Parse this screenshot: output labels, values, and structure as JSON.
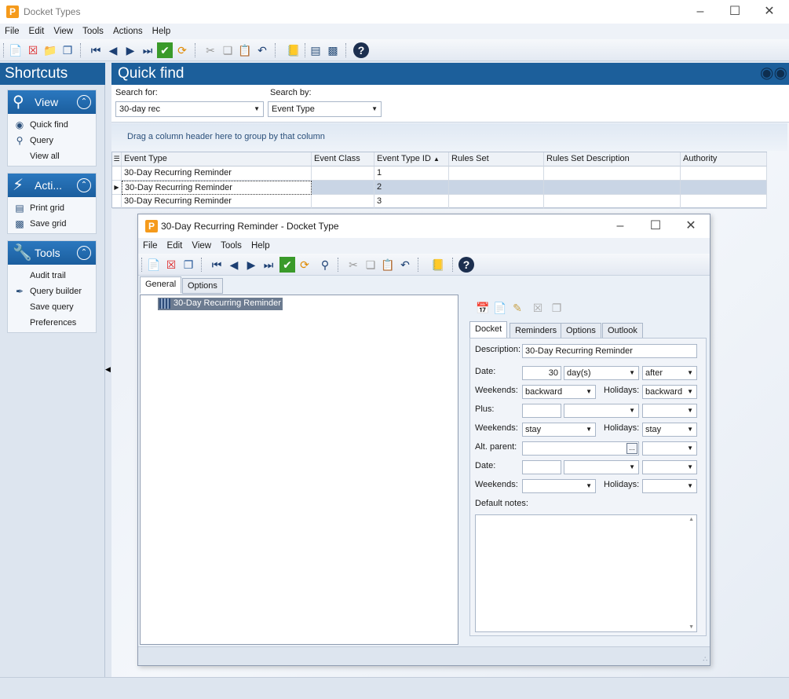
{
  "window": {
    "title": "Docket Types"
  },
  "menu": [
    "File",
    "Edit",
    "View",
    "Tools",
    "Actions",
    "Help"
  ],
  "shortcuts": {
    "title": "Shortcuts",
    "view": {
      "title": "View",
      "items": [
        "Quick find",
        "Query",
        "View all"
      ]
    },
    "actions": {
      "title": "Acti...",
      "items": [
        "Print grid",
        "Save grid"
      ]
    },
    "tools": {
      "title": "Tools",
      "items": [
        "Audit trail",
        "Query builder",
        "Save query",
        "Preferences"
      ]
    }
  },
  "quickfind": {
    "title": "Quick find",
    "search_for_label": "Search for:",
    "search_for_value": "30-day rec",
    "search_by_label": "Search by:",
    "search_by_value": "Event Type"
  },
  "grid": {
    "group_hint": "Drag a column header here to group by that column",
    "columns": [
      "Event Type",
      "Event Class",
      "Event Type ID",
      "Rules Set",
      "Rules Set Description",
      "Authority"
    ],
    "rows": [
      [
        "30-Day Recurring Reminder",
        "",
        "1",
        "",
        "",
        ""
      ],
      [
        "30-Day Recurring Reminder",
        "",
        "2",
        "",
        "",
        ""
      ],
      [
        "30-Day Recurring Reminder",
        "",
        "3",
        "",
        "",
        ""
      ]
    ]
  },
  "dialog": {
    "title": "30-Day Recurring Reminder - Docket Type",
    "menu": [
      "File",
      "Edit",
      "View",
      "Tools",
      "Help"
    ],
    "tabs": [
      "General",
      "Options"
    ],
    "tree_item": "30-Day Recurring Reminder",
    "subtabs": [
      "Docket",
      "Reminders",
      "Options",
      "Outlook"
    ],
    "form": {
      "description_label": "Description:",
      "description_value": "30-Day Recurring Reminder",
      "date_label": "Date:",
      "date_value": "30",
      "date_unit": "day(s)",
      "date_direction": "after",
      "weekends_label": "Weekends:",
      "weekends_value": "backward",
      "holidays_label": "Holidays:",
      "holidays_value": "backward",
      "plus_label": "Plus:",
      "weekends2_value": "stay",
      "holidays2_value": "stay",
      "alt_parent_label": "Alt. parent:",
      "browse_label": "...",
      "default_notes_label": "Default notes:"
    }
  }
}
